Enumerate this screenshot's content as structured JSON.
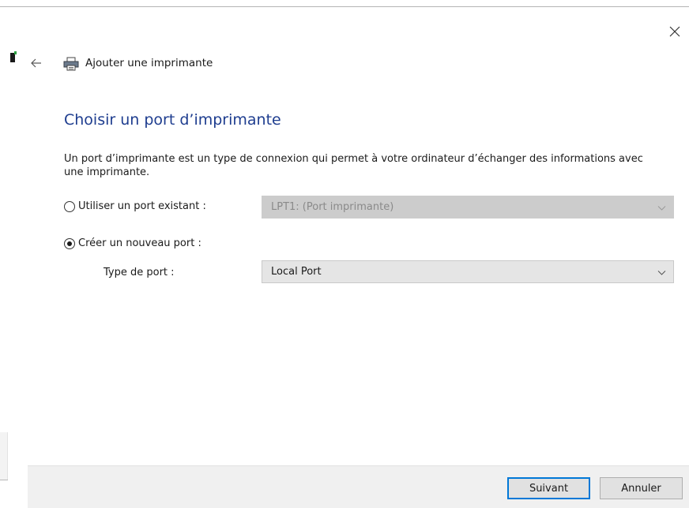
{
  "window": {
    "close_icon": "close-icon"
  },
  "header": {
    "back_icon": "arrow-left-icon",
    "printer_icon": "printer-icon",
    "title": "Ajouter une imprimante"
  },
  "page": {
    "heading": "Choisir un port d’imprimante",
    "description": "Un port d’imprimante est un type de connexion qui permet à votre ordinateur d’échanger des informations avec une imprimante."
  },
  "options": {
    "existing_port": {
      "label": "Utiliser un port existant :",
      "checked": false,
      "select_value": "LPT1: (Port imprimante)",
      "disabled": true
    },
    "new_port": {
      "label": "Créer un nouveau port :",
      "checked": true,
      "port_type_label": "Type de port :",
      "select_value": "Local Port"
    }
  },
  "footer": {
    "next_label": "Suivant",
    "cancel_label": "Annuler"
  },
  "colors": {
    "heading": "#1e3d8f",
    "accent": "#0078d7",
    "footer_bg": "#f0f0f0"
  }
}
